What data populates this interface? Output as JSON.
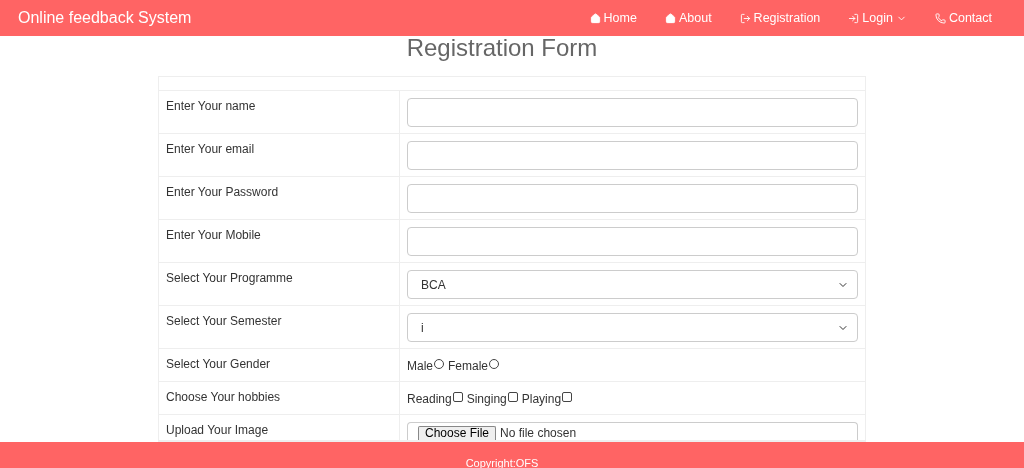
{
  "navbar": {
    "brand": "Online feedback System",
    "items": [
      {
        "label": "Home",
        "dropdown": false
      },
      {
        "label": "About",
        "dropdown": false
      },
      {
        "label": "Registration",
        "dropdown": false
      },
      {
        "label": "Login",
        "dropdown": true
      },
      {
        "label": "Contact",
        "dropdown": false
      }
    ]
  },
  "title": "Registration Form",
  "rows": [
    {
      "kind": "text",
      "label": "Enter Your name"
    },
    {
      "kind": "text",
      "label": "Enter Your email"
    },
    {
      "kind": "text",
      "label": "Enter Your Password"
    },
    {
      "kind": "text",
      "label": "Enter Your Mobile"
    },
    {
      "kind": "select",
      "label": "Select Your Programme",
      "value": "BCA"
    },
    {
      "kind": "select",
      "label": "Select Your Semester",
      "value": "i"
    },
    {
      "kind": "radio",
      "label": "Select Your Gender",
      "options": [
        {
          "label": "Male",
          "selected": false
        },
        {
          "label": "Female",
          "selected": false
        }
      ]
    },
    {
      "kind": "checkbox",
      "label": "Choose Your hobbies",
      "options": [
        {
          "label": "Reading",
          "checked": false
        },
        {
          "label": "Singing",
          "checked": false
        },
        {
          "label": "Playing",
          "checked": false
        }
      ]
    },
    {
      "kind": "file",
      "label": "Upload Your Image",
      "button": "Choose File",
      "status": "No file chosen"
    }
  ],
  "footer": "Copyright:OFS"
}
